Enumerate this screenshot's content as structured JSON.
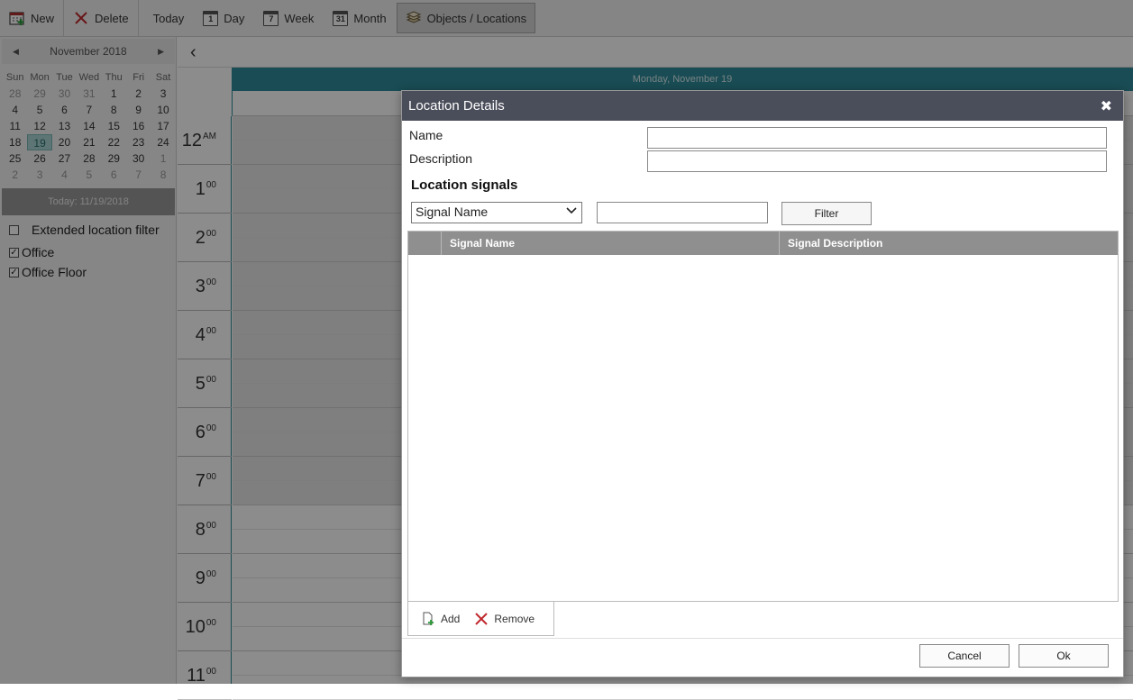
{
  "toolbar": {
    "new": "New",
    "delete": "Delete",
    "today": "Today",
    "day": "Day",
    "week": "Week",
    "month": "Month",
    "objects_locations": "Objects / Locations",
    "day_icon_num": "1",
    "week_icon_num": "7",
    "month_icon_num": "31"
  },
  "mini_calendar": {
    "title": "November 2018",
    "weekdays": [
      "Sun",
      "Mon",
      "Tue",
      "Wed",
      "Thu",
      "Fri",
      "Sat"
    ],
    "weeks": [
      [
        "28",
        "29",
        "30",
        "31",
        "1",
        "2",
        "3"
      ],
      [
        "4",
        "5",
        "6",
        "7",
        "8",
        "9",
        "10"
      ],
      [
        "11",
        "12",
        "13",
        "14",
        "15",
        "16",
        "17"
      ],
      [
        "18",
        "19",
        "20",
        "21",
        "22",
        "23",
        "24"
      ],
      [
        "25",
        "26",
        "27",
        "28",
        "29",
        "30",
        "1"
      ],
      [
        "2",
        "3",
        "4",
        "5",
        "6",
        "7",
        "8"
      ]
    ],
    "selected": "19",
    "today_label": "Today: 11/19/2018"
  },
  "filters": {
    "extended": "Extended location filter",
    "items": [
      "Office",
      "Office Floor"
    ]
  },
  "schedule": {
    "day_header": "Monday, November 19",
    "hours": [
      {
        "h": "12",
        "m": "AM"
      },
      {
        "h": "1",
        "m": "00"
      },
      {
        "h": "2",
        "m": "00"
      },
      {
        "h": "3",
        "m": "00"
      },
      {
        "h": "4",
        "m": "00"
      },
      {
        "h": "5",
        "m": "00"
      },
      {
        "h": "6",
        "m": "00"
      },
      {
        "h": "7",
        "m": "00"
      },
      {
        "h": "8",
        "m": "00"
      },
      {
        "h": "9",
        "m": "00"
      },
      {
        "h": "10",
        "m": "00"
      },
      {
        "h": "11",
        "m": "00"
      }
    ]
  },
  "dialog": {
    "title": "Location Details",
    "name_label": "Name",
    "name_value": "",
    "description_label": "Description",
    "description_value": "",
    "section_title": "Location signals",
    "select_value": "Signal Name",
    "filter_value": "",
    "filter_button": "Filter",
    "columns": [
      "Signal Name",
      "Signal Description"
    ],
    "add": "Add",
    "remove": "Remove",
    "cancel": "Cancel",
    "ok": "Ok"
  },
  "colors": {
    "accent": "#2f8a99",
    "dialog_title_bg": "#4a4d5a",
    "delete_red": "#c0282d"
  }
}
